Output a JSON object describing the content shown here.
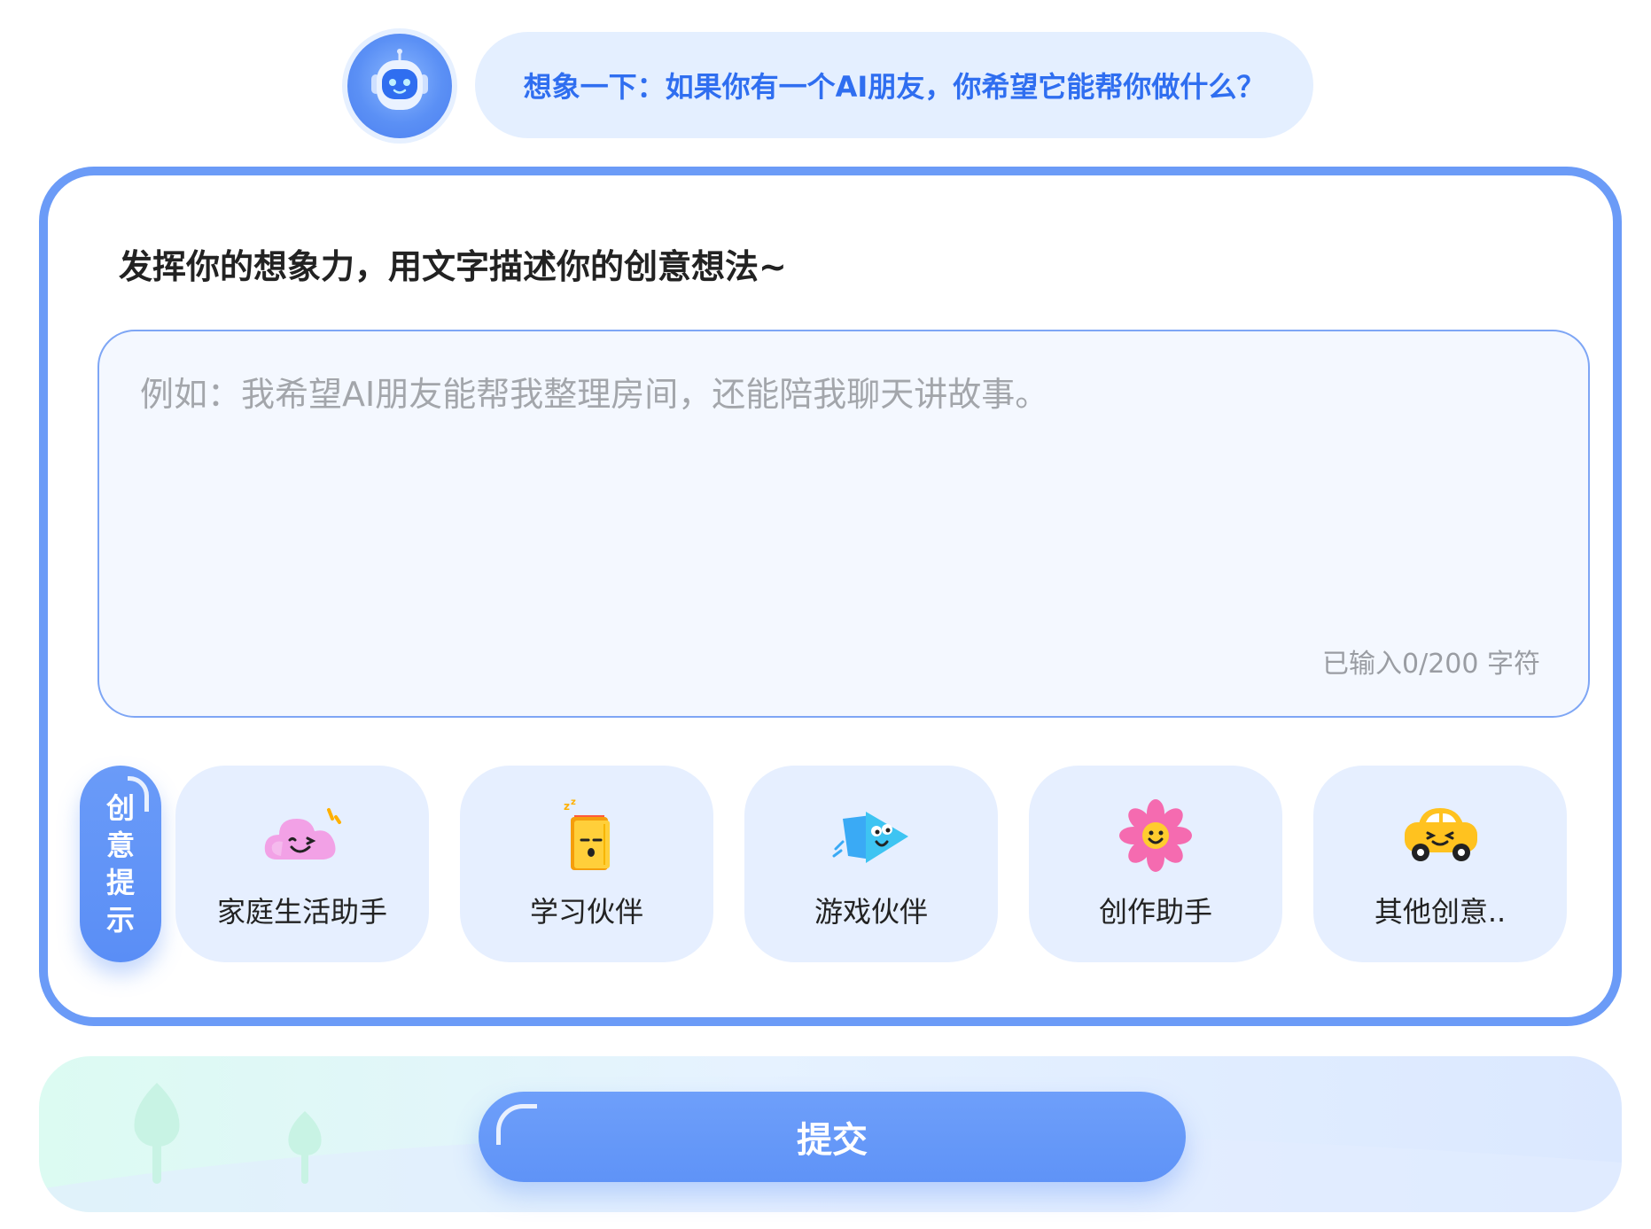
{
  "header": {
    "question": "想象一下：如果你有一个AI朋友，你希望它能帮你做什么？"
  },
  "form": {
    "title": "发挥你的想象力，用文字描述你的创意想法~",
    "placeholder": "例如：我希望AI朋友能帮我整理房间，还能陪我聊天讲故事。",
    "value": "",
    "char_count": "已输入0/200 字符"
  },
  "hints": {
    "tab_chars": [
      "创",
      "意",
      "提",
      "示"
    ],
    "items": [
      {
        "label": "家庭生活助手",
        "icon": "cloud-icon"
      },
      {
        "label": "学习伙伴",
        "icon": "book-icon"
      },
      {
        "label": "游戏伙伴",
        "icon": "play-icon"
      },
      {
        "label": "创作助手",
        "icon": "flower-icon"
      },
      {
        "label": "其他创意..",
        "icon": "car-icon"
      }
    ]
  },
  "footer": {
    "submit_label": "提交"
  },
  "colors": {
    "accent": "#6b9bf7",
    "question_text": "#2f6ef0",
    "bubble_bg": "#e4efff",
    "card_bg": "#e6efff"
  }
}
